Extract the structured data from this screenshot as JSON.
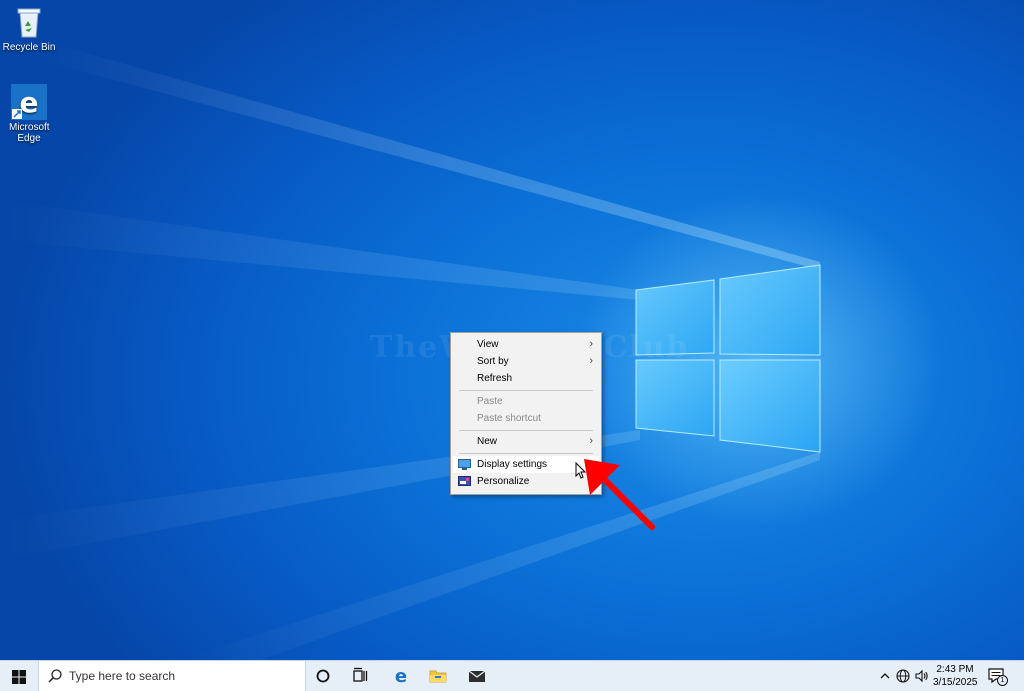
{
  "desktop": {
    "icons": [
      {
        "label": "Recycle Bin",
        "icon": "recycle-bin-icon"
      },
      {
        "label": "Microsoft Edge",
        "icon": "edge-icon"
      }
    ],
    "watermark": "TheWindowsClub"
  },
  "context_menu": {
    "items": [
      {
        "label": "View",
        "has_submenu": true,
        "enabled": true
      },
      {
        "label": "Sort by",
        "has_submenu": true,
        "enabled": true
      },
      {
        "label": "Refresh",
        "has_submenu": false,
        "enabled": true
      },
      {
        "label": "Paste",
        "has_submenu": false,
        "enabled": false
      },
      {
        "label": "Paste shortcut",
        "has_submenu": false,
        "enabled": false
      },
      {
        "label": "New",
        "has_submenu": true,
        "enabled": true
      },
      {
        "label": "Display settings",
        "has_submenu": false,
        "enabled": true,
        "icon": "display-icon",
        "highlighted": true
      },
      {
        "label": "Personalize",
        "has_submenu": false,
        "enabled": true,
        "icon": "personalize-icon"
      }
    ]
  },
  "taskbar": {
    "search_placeholder": "Type here to search",
    "pinned": [
      "cortana-icon",
      "task-view-icon",
      "edge-icon",
      "file-explorer-icon",
      "mail-icon"
    ],
    "tray": {
      "icons": [
        "chevron-up-icon",
        "network-icon",
        "volume-icon"
      ],
      "time": "2:43 PM",
      "date": "3/15/2025",
      "notification_count": "1"
    }
  },
  "colors": {
    "desktop_blue": "#0a6fd6",
    "taskbar_bg": "#e6eef7",
    "menu_bg": "#f2f2f2",
    "annotation_arrow": "#ff0000"
  }
}
